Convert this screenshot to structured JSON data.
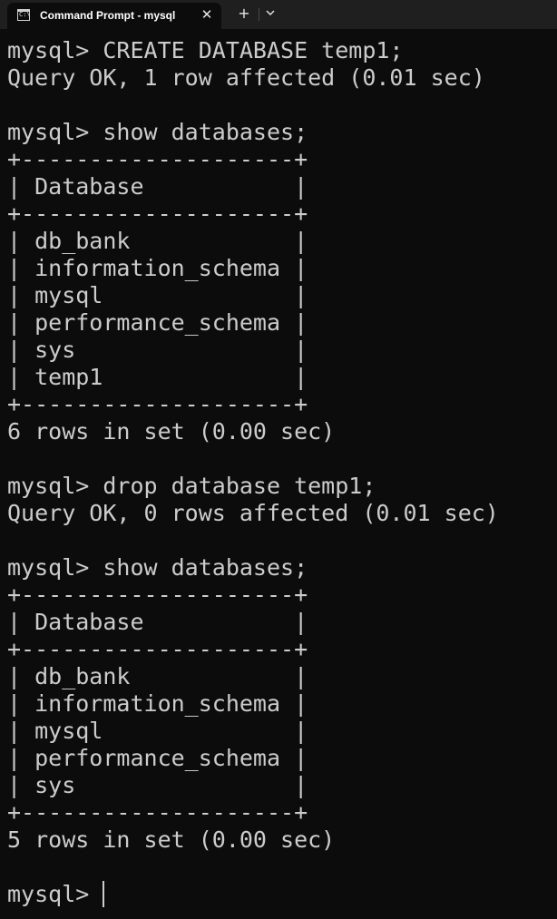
{
  "tab": {
    "title": "Command Prompt - mysql  -u",
    "icon": "command-prompt-icon",
    "close_label": "✕"
  },
  "toolbar": {
    "new_tab_label": "+",
    "dropdown_icon": "chevron-down-icon"
  },
  "terminal": {
    "lines": [
      "mysql> CREATE DATABASE temp1;",
      "Query OK, 1 row affected (0.01 sec)",
      "",
      "mysql> show databases;",
      "+--------------------+",
      "| Database           |",
      "+--------------------+",
      "| db_bank            |",
      "| information_schema |",
      "| mysql              |",
      "| performance_schema |",
      "| sys                |",
      "| temp1              |",
      "+--------------------+",
      "6 rows in set (0.00 sec)",
      "",
      "mysql> drop database temp1;",
      "Query OK, 0 rows affected (0.01 sec)",
      "",
      "mysql> show databases;",
      "+--------------------+",
      "| Database           |",
      "+--------------------+",
      "| db_bank            |",
      "| information_schema |",
      "| mysql              |",
      "| performance_schema |",
      "| sys                |",
      "+--------------------+",
      "5 rows in set (0.00 sec)",
      "",
      "mysql> "
    ],
    "foreground": "#cccccc",
    "background": "#0c0c0c"
  }
}
